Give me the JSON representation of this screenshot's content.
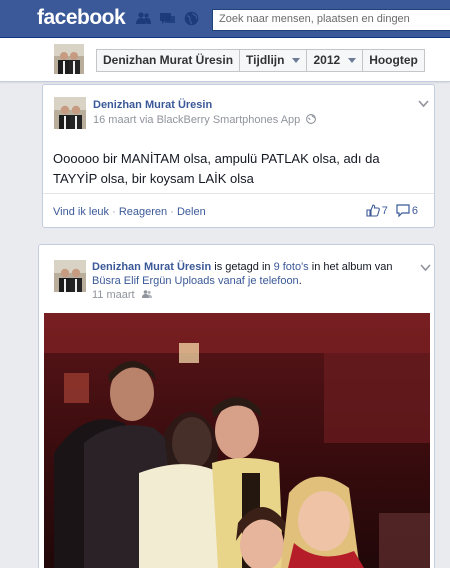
{
  "topbar": {
    "logo": "facebook",
    "search_placeholder": "Zoek naar mensen, plaatsen en dingen",
    "icons": [
      "friends-icon",
      "messages-icon",
      "notifications-icon"
    ],
    "brand_color": "#3b5998"
  },
  "subnav": {
    "crumbs": [
      {
        "label": "Denizhan Murat Üresin"
      },
      {
        "label": "Tijdlijn"
      },
      {
        "label": "2012"
      },
      {
        "label": "Hoogtep"
      }
    ]
  },
  "post1": {
    "author": "Denizhan Murat Üresin",
    "meta": "16 maart via BlackBerry Smartphones App",
    "text": "Oooooo bir MANİTAM olsa, ampulü PATLAK olsa, adı da TAYYİP olsa, bir koysam LAİK olsa",
    "actions": {
      "like": "Vind ik leuk",
      "sep": " · ",
      "comment": "Reageren",
      "share": "Delen"
    },
    "likes": "7",
    "comments": "6"
  },
  "post2": {
    "author": "Denizhan Murat Üresin",
    "tagged_text": " is getagd in ",
    "photos_link": "9 foto's",
    "album_text": " in het album van ",
    "album_link": "Büsra Elif Ergün Uploads vanaf je telefoon",
    "period": ".",
    "date": "11 maart"
  }
}
